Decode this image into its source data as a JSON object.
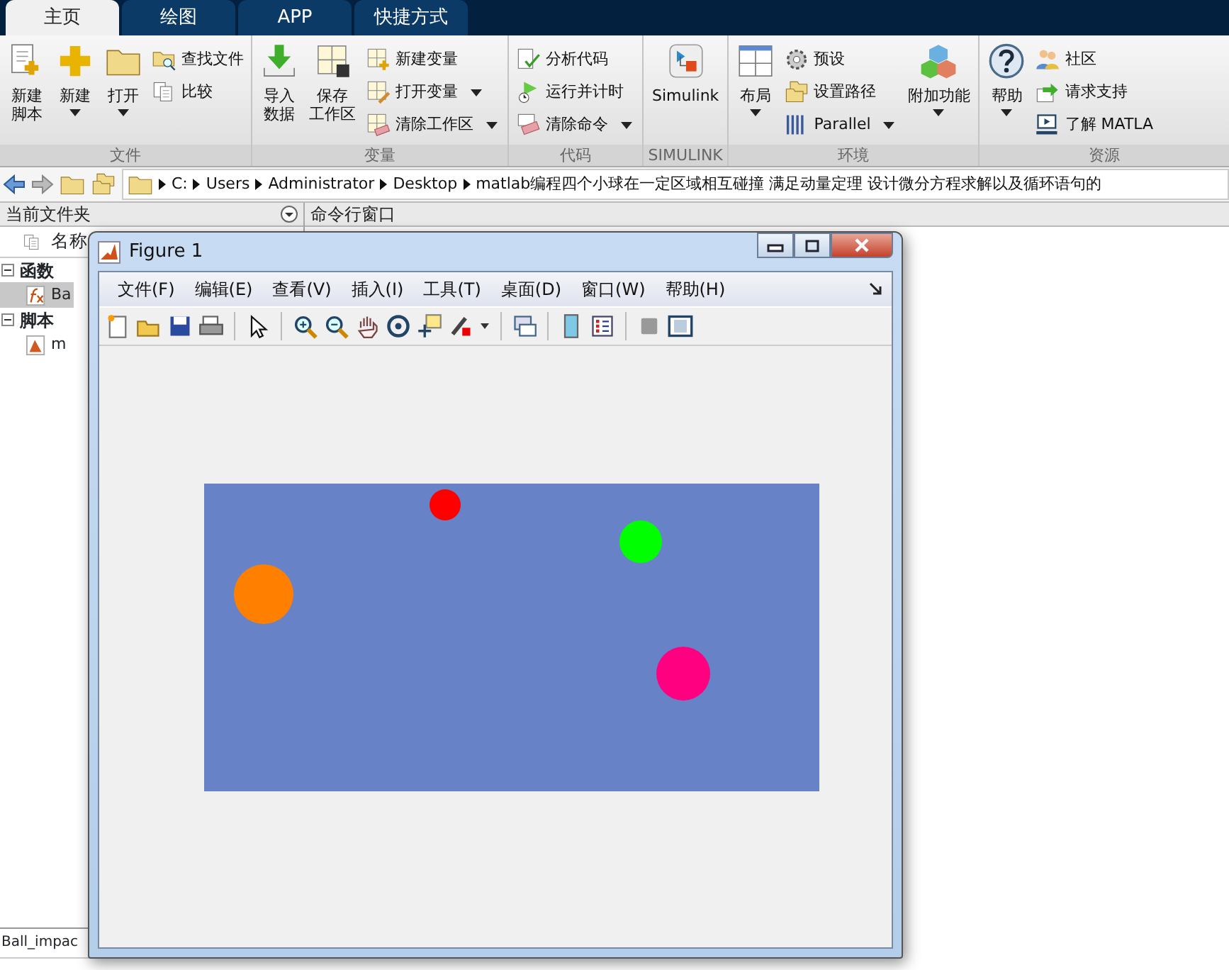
{
  "tabs": [
    {
      "label": "主页",
      "selected": true
    },
    {
      "label": "绘图",
      "selected": false
    },
    {
      "label": "APP",
      "selected": false
    },
    {
      "label": "快捷方式",
      "selected": false
    }
  ],
  "ribbon": [
    {
      "title": "文件",
      "columns": [
        {
          "kind": "big",
          "lines": [
            "新建",
            "脚本"
          ],
          "dropdown": false
        },
        {
          "kind": "big",
          "lines": [
            "新建"
          ],
          "dropdown": true
        },
        {
          "kind": "big",
          "lines": [
            "打开"
          ],
          "dropdown": true
        },
        {
          "kind": "stack",
          "items": [
            {
              "label": "查找文件",
              "dropdown": false
            },
            {
              "label": "比较",
              "dropdown": false
            }
          ]
        }
      ]
    },
    {
      "title": "变量",
      "columns": [
        {
          "kind": "big",
          "lines": [
            "导入",
            "数据"
          ],
          "dropdown": false
        },
        {
          "kind": "big",
          "lines": [
            "保存",
            "工作区"
          ],
          "dropdown": false
        },
        {
          "kind": "stack",
          "items": [
            {
              "label": "新建变量",
              "dropdown": false
            },
            {
              "label": "打开变量",
              "dropdown": true
            },
            {
              "label": "清除工作区",
              "dropdown": true
            }
          ]
        }
      ]
    },
    {
      "title": "代码",
      "columns": [
        {
          "kind": "stack",
          "items": [
            {
              "label": "分析代码",
              "dropdown": false
            },
            {
              "label": "运行并计时",
              "dropdown": false
            },
            {
              "label": "清除命令",
              "dropdown": true
            }
          ]
        }
      ]
    },
    {
      "title": "SIMULINK",
      "columns": [
        {
          "kind": "big",
          "lines": [
            "Simulink"
          ],
          "dropdown": false
        }
      ]
    },
    {
      "title": "环境",
      "columns": [
        {
          "kind": "big",
          "lines": [
            "布局"
          ],
          "dropdown": true
        },
        {
          "kind": "stack",
          "items": [
            {
              "label": "预设",
              "dropdown": false
            },
            {
              "label": "设置路径",
              "dropdown": false
            },
            {
              "label": "Parallel",
              "dropdown": true
            }
          ]
        },
        {
          "kind": "big",
          "lines": [
            "附加功能"
          ],
          "dropdown": true
        }
      ]
    },
    {
      "title": "资源",
      "columns": [
        {
          "kind": "big",
          "lines": [
            "帮助"
          ],
          "dropdown": true
        },
        {
          "kind": "stack",
          "items": [
            {
              "label": "社区",
              "dropdown": false
            },
            {
              "label": "请求支持",
              "dropdown": false
            },
            {
              "label": "了解 MATLA",
              "dropdown": false
            }
          ]
        }
      ]
    }
  ],
  "address": [
    "C:",
    "Users",
    "Administrator",
    "Desktop",
    "matlab编程四个小球在一定区域相互碰撞 满足动量定理 设计微分方程求解以及循环语句的"
  ],
  "current_folder": {
    "title": "当前文件夹",
    "column": "名称",
    "tree": [
      {
        "label": "函数",
        "expanded": true,
        "children": [
          {
            "label": "Ba",
            "selected": true
          }
        ]
      },
      {
        "label": "脚本",
        "expanded": true,
        "children": [
          {
            "label": "m",
            "selected": false
          }
        ]
      }
    ],
    "details": "Ball_impac"
  },
  "command_window": {
    "title": "命令行窗口"
  },
  "figure": {
    "title": "Figure 1",
    "menu": [
      "文件(F)",
      "编辑(E)",
      "查看(V)",
      "插入(I)",
      "工具(T)",
      "桌面(D)",
      "窗口(W)",
      "帮助(H)"
    ],
    "balls": [
      {
        "color": "#ff0000"
      },
      {
        "color": "#00ff00"
      },
      {
        "color": "#ff8000"
      },
      {
        "color": "#ff0080"
      }
    ]
  }
}
